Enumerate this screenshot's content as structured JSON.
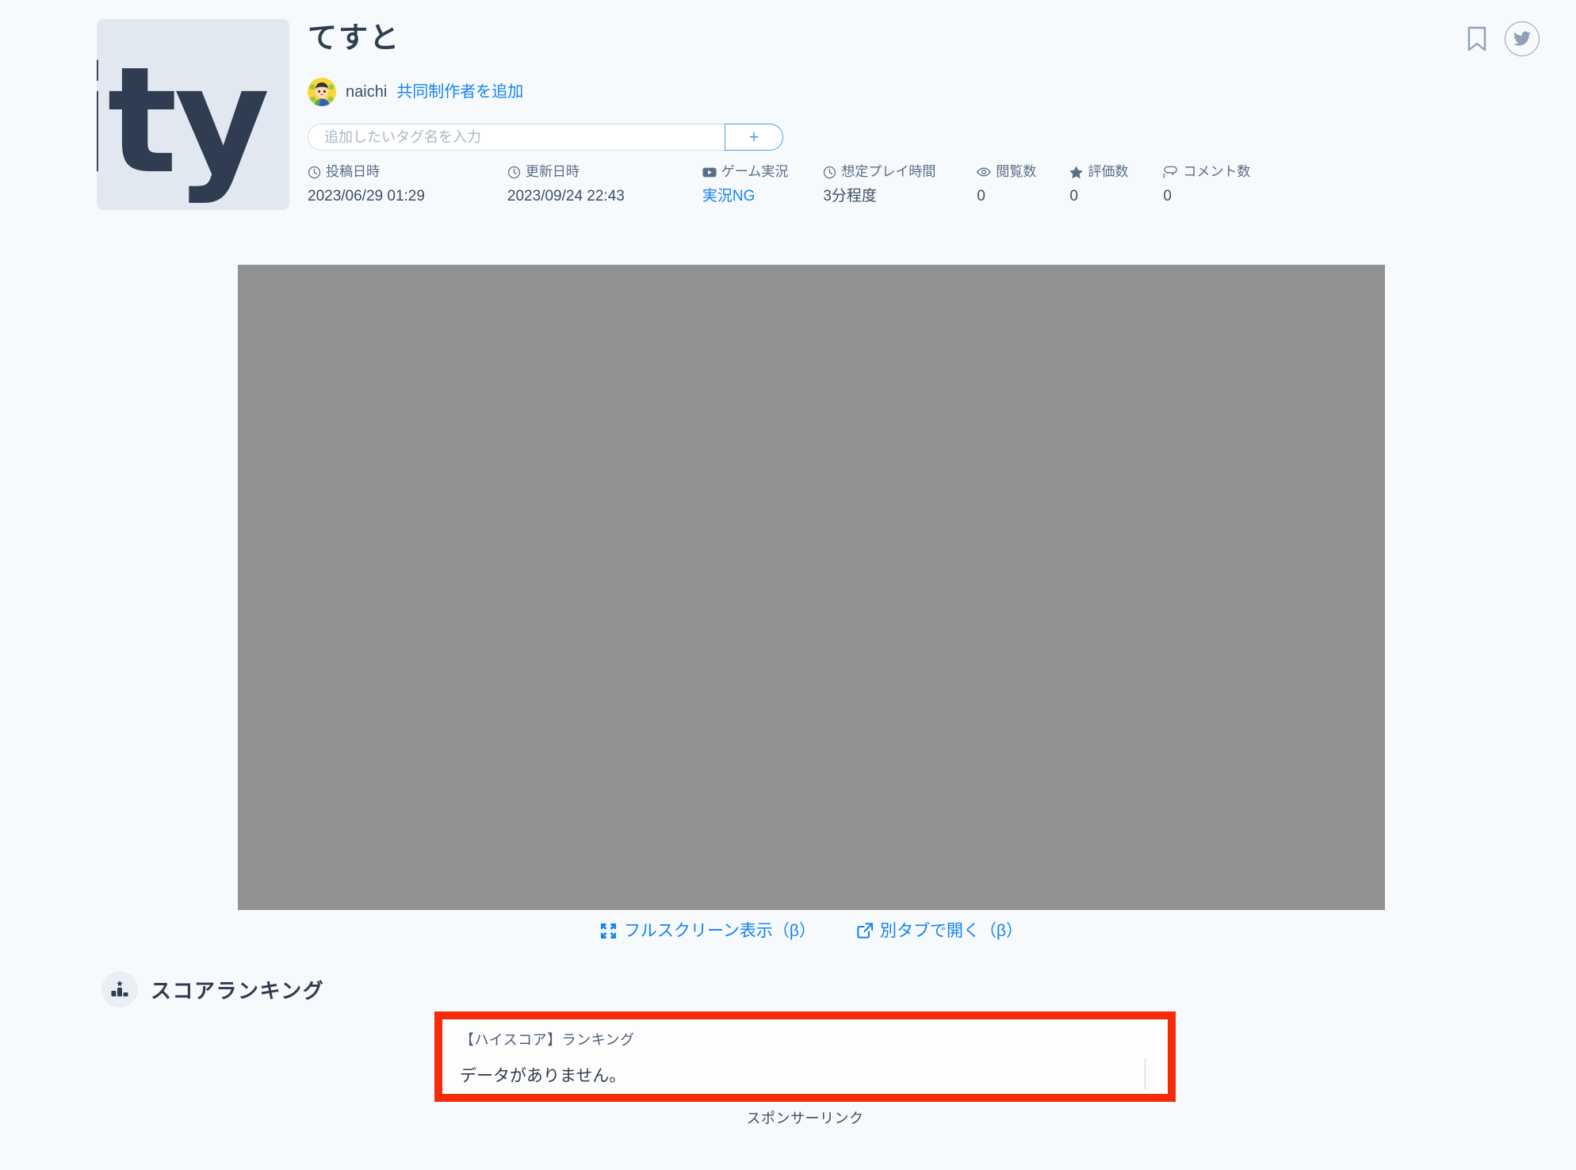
{
  "page": {
    "background_color": "#f7fafc",
    "canvas_color": "#919191",
    "accent_color": "#1583f2",
    "highlight_border_color": "#f62b0a"
  },
  "header": {
    "thumbnail_text": "ity",
    "title": "てすと",
    "author": {
      "name": "naichi",
      "add_collaborator_label": "共同制作者を追加"
    },
    "tag_input": {
      "value": "",
      "placeholder": "追加したいタグ名を入力",
      "add_button_label": "+"
    },
    "top_icons": {
      "bookmark": "bookmark-icon",
      "twitter": "twitter-icon"
    }
  },
  "meta": [
    {
      "icon": "clock-icon",
      "label": "投稿日時",
      "value": "2023/06/29 01:29",
      "is_link": false
    },
    {
      "icon": "clock-icon",
      "label": "更新日時",
      "value": "2023/09/24 22:43",
      "is_link": false
    },
    {
      "icon": "video-icon",
      "label": "ゲーム実況",
      "value": "実況NG",
      "is_link": true
    },
    {
      "icon": "clock-icon",
      "label": "想定プレイ時間",
      "value": "3分程度",
      "is_link": false
    },
    {
      "icon": "eye-icon",
      "label": "閲覧数",
      "value": "0",
      "is_link": false
    },
    {
      "icon": "star-icon",
      "label": "評価数",
      "value": "0",
      "is_link": false
    },
    {
      "icon": "comment-icon",
      "label": "コメント数",
      "value": "0",
      "is_link": false
    }
  ],
  "canvas_actions": [
    {
      "icon": "fullscreen-icon",
      "label": "フルスクリーン表示（β）"
    },
    {
      "icon": "external-link-icon",
      "label": "別タブで開く（β）"
    }
  ],
  "score_section": {
    "icon": "ranking-podium-icon",
    "title": "スコアランキング",
    "ranking_label": "【ハイスコア】ランキング",
    "empty_message": "データがありません。"
  },
  "sponsor": {
    "label": "スポンサーリンク"
  }
}
